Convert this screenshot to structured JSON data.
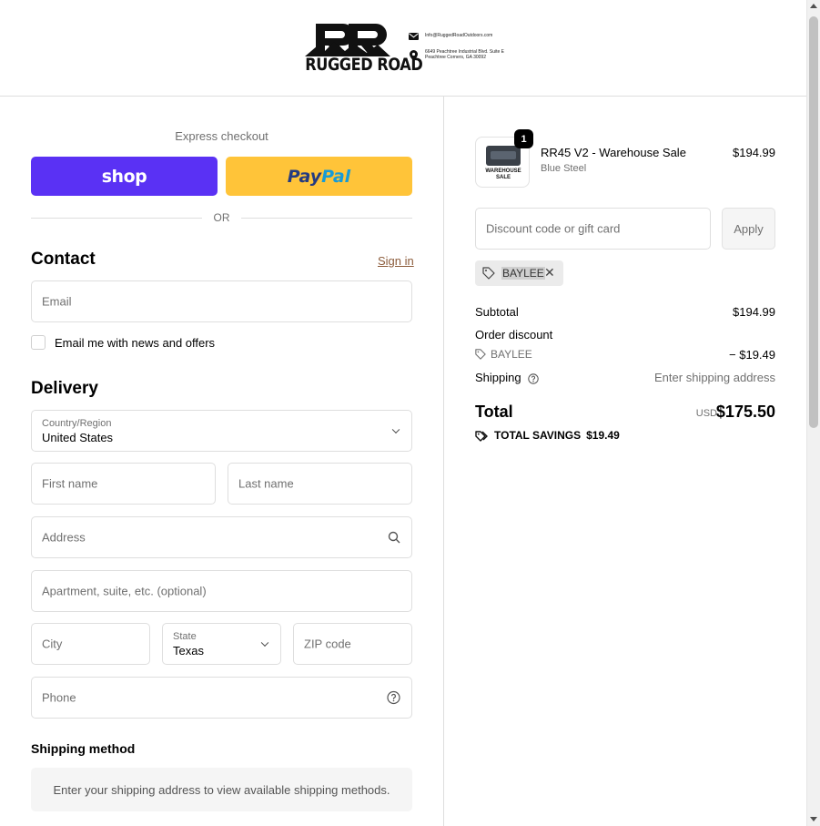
{
  "header": {
    "brand": "RUGGED ROAD",
    "email": "Info@RuggedRoadOutdoors.com",
    "address": "6649 Peachtree Industrial Blvd. Suite E Peachtree Corners, GA 30092"
  },
  "express": {
    "title": "Express checkout",
    "shop_label": "shop",
    "paypal_pay": "Pay",
    "paypal_pal": "Pal",
    "or_label": "OR"
  },
  "contact": {
    "heading": "Contact",
    "sign_in": "Sign in",
    "email_placeholder": "Email",
    "newsletter_label": "Email me with news and offers"
  },
  "delivery": {
    "heading": "Delivery",
    "country_label": "Country/Region",
    "country_value": "United States",
    "first_name_placeholder": "First name",
    "last_name_placeholder": "Last name",
    "address_placeholder": "Address",
    "apartment_placeholder": "Apartment, suite, etc. (optional)",
    "city_placeholder": "City",
    "state_label": "State",
    "state_value": "Texas",
    "zip_placeholder": "ZIP code",
    "phone_placeholder": "Phone"
  },
  "shipping_method": {
    "heading": "Shipping method",
    "message": "Enter your shipping address to view available shipping methods."
  },
  "order": {
    "quantity": "1",
    "product_name": "RR45 V2 - Warehouse Sale",
    "variant": "Blue Steel",
    "price": "$194.99",
    "thumb_label": "WAREHOUSE SALE",
    "discount_placeholder": "Discount code or gift card",
    "apply_label": "Apply",
    "applied_code": "BAYLEE"
  },
  "summary": {
    "subtotal_label": "Subtotal",
    "subtotal_value": "$194.99",
    "order_discount_label": "Order discount",
    "discount_code": "BAYLEE",
    "discount_value": "− $19.49",
    "shipping_label": "Shipping",
    "shipping_value": "Enter shipping address",
    "total_label": "Total",
    "currency": "USD",
    "total_value": "$175.50",
    "savings_label": "TOTAL SAVINGS",
    "savings_value": "$19.49"
  },
  "colors": {
    "shop_purple": "#5a31f4",
    "paypal_yellow": "#ffc439",
    "link_brown": "#8b5b3a"
  }
}
